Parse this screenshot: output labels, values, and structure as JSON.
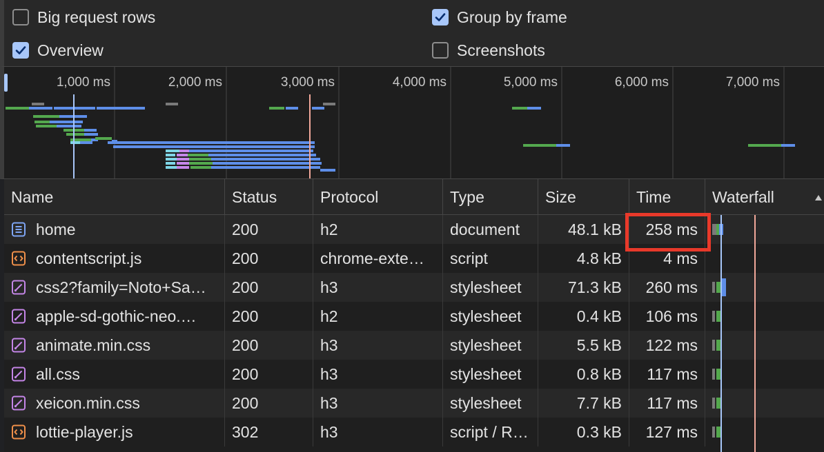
{
  "settings": {
    "big_request_rows": {
      "label": "Big request rows",
      "checked": false
    },
    "group_by_frame": {
      "label": "Group by frame",
      "checked": true
    },
    "overview": {
      "label": "Overview",
      "checked": true
    },
    "screenshots": {
      "label": "Screenshots",
      "checked": false
    }
  },
  "overview": {
    "ticks": [
      "1,000 ms",
      "2,000 ms",
      "3,000 ms",
      "4,000 ms",
      "5,000 ms",
      "6,000 ms",
      "7,000 ms"
    ]
  },
  "colors": {
    "blue_bar": "#5e8ee8",
    "green_bar": "#54a84e",
    "gray_bar": "#7a7a7a",
    "cyan_bar": "#7fd6e6",
    "purple_bar": "#c586e8",
    "dom_line": "#a8c7fa",
    "load_line": "#f2a89a",
    "highlight": "#e8392a"
  },
  "table": {
    "headers": [
      "Name",
      "Status",
      "Protocol",
      "Type",
      "Size",
      "Time",
      "Waterfall"
    ],
    "sort_icon": "sort-ascending-icon",
    "rows": [
      {
        "icon": "document-icon",
        "name": "home",
        "status": "200",
        "protocol": "h2",
        "type": "document",
        "size": "48.1 kB",
        "time": "258 ms"
      },
      {
        "icon": "script-icon",
        "name": "contentscript.js",
        "status": "200",
        "protocol": "chrome-exte…",
        "type": "script",
        "size": "4.8 kB",
        "time": "4 ms"
      },
      {
        "icon": "stylesheet-icon",
        "name": "css2?family=Noto+Sa…",
        "status": "200",
        "protocol": "h3",
        "type": "stylesheet",
        "size": "71.3 kB",
        "time": "260 ms"
      },
      {
        "icon": "stylesheet-icon",
        "name": "apple-sd-gothic-neo.…",
        "status": "200",
        "protocol": "h2",
        "type": "stylesheet",
        "size": "0.4 kB",
        "time": "106 ms"
      },
      {
        "icon": "stylesheet-icon",
        "name": "animate.min.css",
        "status": "200",
        "protocol": "h3",
        "type": "stylesheet",
        "size": "5.5 kB",
        "time": "122 ms"
      },
      {
        "icon": "stylesheet-icon",
        "name": "all.css",
        "status": "200",
        "protocol": "h3",
        "type": "stylesheet",
        "size": "0.8 kB",
        "time": "117 ms"
      },
      {
        "icon": "stylesheet-icon",
        "name": "xeicon.min.css",
        "status": "200",
        "protocol": "h3",
        "type": "stylesheet",
        "size": "7.7 kB",
        "time": "117 ms"
      },
      {
        "icon": "script-icon",
        "name": "lottie-player.js",
        "status": "302",
        "protocol": "h3",
        "type": "script / R…",
        "size": "0.3 kB",
        "time": "127 ms"
      }
    ]
  }
}
